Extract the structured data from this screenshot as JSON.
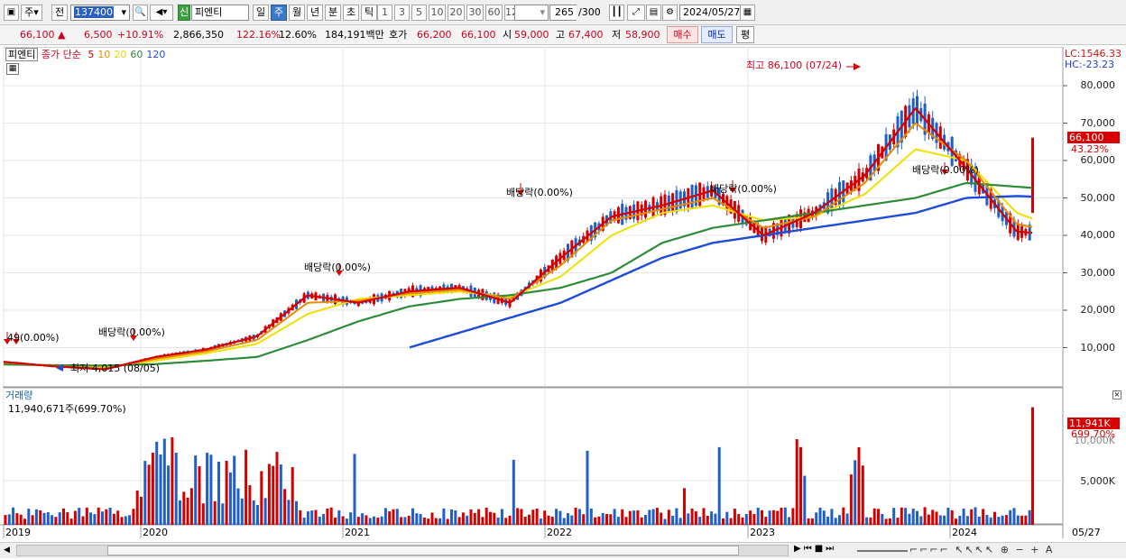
{
  "toolbar": {
    "market_label": "주",
    "prev_label": "전",
    "code_value": "137400",
    "cat_badge": "신",
    "stock_name": "피엔티",
    "period_tabs": [
      "일",
      "주",
      "월",
      "년",
      "분",
      "초",
      "틱"
    ],
    "active_period": "주",
    "number_tabs": [
      "1",
      "3",
      "5",
      "10",
      "20",
      "30",
      "60",
      "120"
    ],
    "count_value": "265",
    "count_total": "/300",
    "date_value": "2024/05/27"
  },
  "infobar": {
    "price": "66,100",
    "change": "6,500",
    "change_pct": "+10.91%",
    "volume": "2,866,350",
    "vol_ratio": "122.16%",
    "turnover": "12.60%",
    "amount": "184,191백만",
    "quote_label": "호가",
    "ask": "66,200",
    "bid": "66,100",
    "open_label": "시",
    "open": "59,000",
    "high_label": "고",
    "high": "67,400",
    "low_label": "저",
    "low": "58,900",
    "buy_button": "매수",
    "sell_button": "매도",
    "eval_button": "평"
  },
  "price_panel": {
    "legend_name": "피엔티",
    "legend_ma_title": "종가 단순",
    "legend_ma": [
      {
        "label": "5",
        "color": "#d40000"
      },
      {
        "label": "10",
        "color": "#e88a00"
      },
      {
        "label": "20",
        "color": "#e8d800"
      },
      {
        "label": "60",
        "color": "#2e8b3a"
      },
      {
        "label": "120",
        "color": "#1e4cd8"
      }
    ],
    "lc_text": "LC:1546.33",
    "hc_text": "HC:-23.23",
    "current_tag": "66,100",
    "current_pct": "43.23%",
    "y_ticks": [
      10000,
      20000,
      30000,
      40000,
      50000,
      60000,
      70000,
      80000
    ],
    "y_tick_labels": [
      "10,000",
      "20,000",
      "30,000",
      "40,000",
      "50,000",
      "60,000",
      "70,000",
      "80,000"
    ],
    "annotations": {
      "high": "최고 86,100 (07/24)",
      "low": "최저 4,015 (08/05)",
      "div1": "배당락(0.00%)",
      "div2": "배당락(0.00%)",
      "div3": "배당락(0.00%)",
      "div4": "배당락(0.00%)",
      "div5": "배당락(0.00%)",
      "div_left": "49(0.00%)"
    }
  },
  "volume_panel": {
    "title": "거래량",
    "value": "11,940,671주(699.70%)",
    "current_tag": "11,941K",
    "current_pct": "699.70%",
    "y_tick_label": "5,000K",
    "y_tick_label_top": "10,000K"
  },
  "x_axis": {
    "labels": [
      "2019",
      "2020",
      "2021",
      "2022",
      "2023",
      "2024"
    ],
    "end_label": "05/27"
  },
  "colors": {
    "up": "#d40000",
    "down": "#1e5fc8",
    "ma5": "#d40000",
    "ma10": "#e88a00",
    "ma20": "#f0e000",
    "ma60": "#2e8b3a",
    "ma120": "#1e4cd8",
    "grid": "#e6e6e6"
  },
  "chart_data": {
    "type": "line",
    "title": "",
    "x": [
      "2019-01",
      "2019-04",
      "2019-07",
      "2019-10",
      "2020-01",
      "2020-04",
      "2020-07",
      "2020-10",
      "2021-01",
      "2021-04",
      "2021-07",
      "2021-10",
      "2022-01",
      "2022-04",
      "2022-07",
      "2022-10",
      "2023-01",
      "2023-04",
      "2023-07",
      "2023-10",
      "2024-01",
      "2024-04",
      "2024-05"
    ],
    "series": [
      {
        "name": "5",
        "values": [
          6200,
          5000,
          4200,
          7500,
          9500,
          13000,
          24000,
          22000,
          25000,
          26000,
          22000,
          34000,
          45000,
          48000,
          52000,
          40000,
          46000,
          56000,
          74000,
          58000,
          41000,
          40000,
          66100
        ]
      },
      {
        "name": "10",
        "values": [
          6000,
          5100,
          4400,
          7000,
          9000,
          12000,
          22000,
          22500,
          24500,
          25500,
          23000,
          32000,
          44000,
          47000,
          50000,
          42000,
          45000,
          54000,
          70000,
          60000,
          43000,
          40500,
          52000
        ]
      },
      {
        "name": "20",
        "values": [
          5800,
          5200,
          4700,
          6500,
          8500,
          11000,
          19000,
          23000,
          24000,
          25000,
          23500,
          29000,
          40000,
          46000,
          48000,
          44000,
          45000,
          51000,
          63000,
          60000,
          46000,
          41000,
          45000
        ]
      },
      {
        "name": "60",
        "values": [
          5500,
          5300,
          5200,
          5600,
          6500,
          7500,
          12000,
          17000,
          21000,
          23000,
          24000,
          26000,
          30000,
          38000,
          42000,
          44000,
          46000,
          48000,
          50000,
          54000,
          53000,
          52000,
          52500
        ]
      },
      {
        "name": "120",
        "values": [
          null,
          null,
          null,
          null,
          null,
          null,
          null,
          null,
          10000,
          14000,
          18000,
          22000,
          28000,
          34000,
          38000,
          40000,
          42000,
          44000,
          46000,
          50000,
          50500,
          50000,
          50000
        ]
      }
    ],
    "ylim": [
      0,
      86100
    ],
    "volume": {
      "ylim": [
        0,
        13000
      ],
      "current": 11941
    }
  }
}
